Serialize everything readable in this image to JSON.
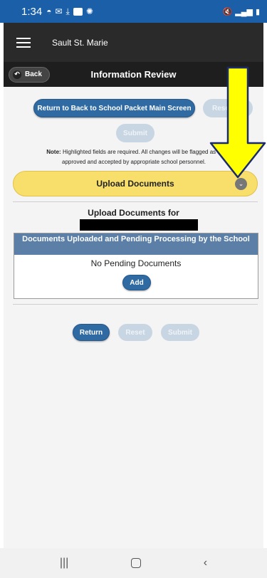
{
  "status_bar": {
    "time": "1:34"
  },
  "header": {
    "app_title": "Sault St. Marie"
  },
  "sub_header": {
    "back_label": "Back",
    "page_title": "Information Review"
  },
  "top_actions": {
    "return_main_label": "Return to Back to School Packet Main Screen",
    "reset_label": "Reset",
    "submit_label": "Submit"
  },
  "note": {
    "prefix": "Note:",
    "line1": "Highlighted fields are required. All changes will be flagged as P",
    "line2": "approved and accepted by appropriate school personnel."
  },
  "upload_section": {
    "title": "Upload Documents",
    "upload_for_label": "Upload Documents for",
    "docs_header": "Documents Uploaded and Pending Processing by the School",
    "no_pending": "No Pending Documents",
    "add_label": "Add"
  },
  "bottom_actions": {
    "return_label": "Return",
    "reset_label": "Reset",
    "submit_label": "Submit"
  },
  "colors": {
    "accent": "#2f6aa2",
    "upload_bar": "#f8df6c",
    "arrow": "#ffff00"
  }
}
